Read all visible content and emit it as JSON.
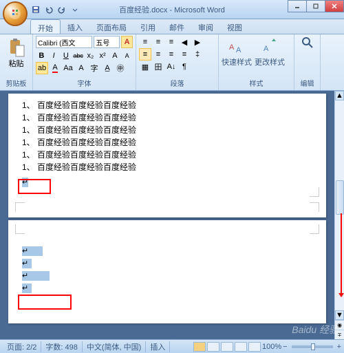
{
  "title": "百度经验.docx - Microsoft Word",
  "tabs": [
    "开始",
    "插入",
    "页面布局",
    "引用",
    "邮件",
    "审阅",
    "视图"
  ],
  "active_tab": 0,
  "font": {
    "name": "Calibri (西文",
    "size": "五号"
  },
  "groups": {
    "clipboard": "剪贴板",
    "font": "字体",
    "paragraph": "段落",
    "styles": "样式",
    "editing": "编辑"
  },
  "paste": "粘贴",
  "styles": {
    "quick": "快速样式",
    "change": "更改样式"
  },
  "doc_lines": [
    "1、 百度经验百度经验百度经验",
    "1、 百度经验百度经验百度经验",
    "1、 百度经验百度经验百度经验",
    "1、 百度经验百度经验百度经验",
    "1、 百度经验百度经验百度经验",
    "1、 百度经验百度经验百度经验"
  ],
  "status": {
    "page": "页面: 2/2",
    "words": "字数: 498",
    "lang": "中文(简体, 中国)",
    "mode": "插入",
    "zoom": "100%"
  },
  "buttons": {
    "bold": "B",
    "italic": "I",
    "underline": "U",
    "strike": "abc",
    "sub": "x₂",
    "sup": "x²",
    "a_up": "A",
    "a_dn": "A",
    "clear": "Aa",
    "hl": "ab",
    "color": "A"
  },
  "zoom_minus": "−",
  "zoom_plus": "+",
  "watermark": "Baidu 经验"
}
